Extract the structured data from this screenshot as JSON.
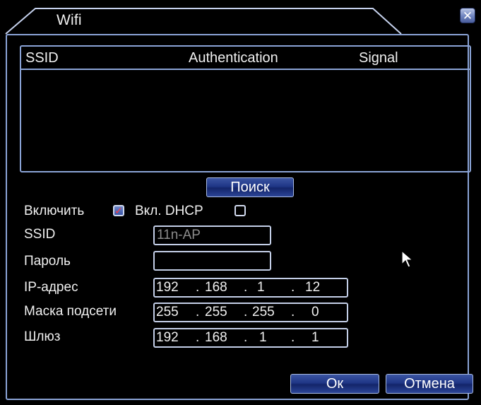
{
  "window": {
    "title": "Wifi",
    "close_label": "✕"
  },
  "network_list": {
    "columns": [
      "SSID",
      "Authentication",
      "Signal"
    ],
    "rows": []
  },
  "search_button": "Поиск",
  "enable": {
    "label": "Включить",
    "checked": true
  },
  "dhcp": {
    "label": "Вкл. DHCP",
    "checked": false
  },
  "ssid": {
    "label": "SSID",
    "value": "11n-AP"
  },
  "password": {
    "label": "Пароль",
    "value": ""
  },
  "ip": {
    "label": "IP-адрес",
    "octets": [
      "192",
      "168",
      "1",
      "12"
    ]
  },
  "mask": {
    "label": "Маска подсети",
    "octets": [
      "255",
      "255",
      "255",
      "0"
    ]
  },
  "gateway": {
    "label": "Шлюз",
    "octets": [
      "192",
      "168",
      "1",
      "1"
    ]
  },
  "ok_button": "Ок",
  "cancel_button": "Отмена",
  "colors": {
    "background": "#000000",
    "frame": "#8aa3d6",
    "button": "#1f3686",
    "text": "#f0f0f0"
  }
}
